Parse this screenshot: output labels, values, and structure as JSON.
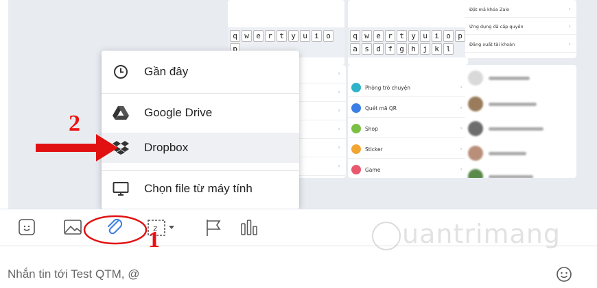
{
  "keyboard": {
    "row1": [
      "q",
      "w",
      "e",
      "r",
      "t",
      "y",
      "u",
      "i",
      "o",
      "p"
    ],
    "row2": [
      "a",
      "s",
      "d",
      "f",
      "g",
      "h",
      "j",
      "k",
      "l"
    ]
  },
  "settings_panel": {
    "items": [
      "Đặt mã khóa Zalo",
      "Ứng dụng đã cấp quyền",
      "Đăng xuất tài khoản"
    ]
  },
  "features_panel": {
    "items": [
      {
        "label": "Phòng trò chuyện",
        "color": "#2fb3c9"
      },
      {
        "label": "Quét mã QR",
        "color": "#3a7ee6"
      },
      {
        "label": "Shop",
        "color": "#7bc043"
      },
      {
        "label": "Sticker",
        "color": "#f1a533"
      },
      {
        "label": "Game",
        "color": "#e8596d"
      }
    ]
  },
  "attach_menu": {
    "items": [
      {
        "label": "Gần đây",
        "icon": "clock-icon"
      },
      {
        "label": "Google Drive",
        "icon": "google-drive-icon"
      },
      {
        "label": "Dropbox",
        "icon": "dropbox-icon",
        "highlighted": true
      },
      {
        "label": "Chọn file từ máy tính",
        "icon": "monitor-icon"
      }
    ]
  },
  "toolbar": {
    "icons": [
      "sticker-icon",
      "image-icon",
      "attachment-icon",
      "screenshot-icon",
      "flag-icon",
      "poll-icon"
    ]
  },
  "composer": {
    "placeholder": "Nhắn tin tới Test QTM, @",
    "emoji_icon": "emoji-icon"
  },
  "annotations": {
    "step1": "1",
    "step2": "2",
    "accent_color": "#e11111"
  },
  "watermark": "uantrimang"
}
